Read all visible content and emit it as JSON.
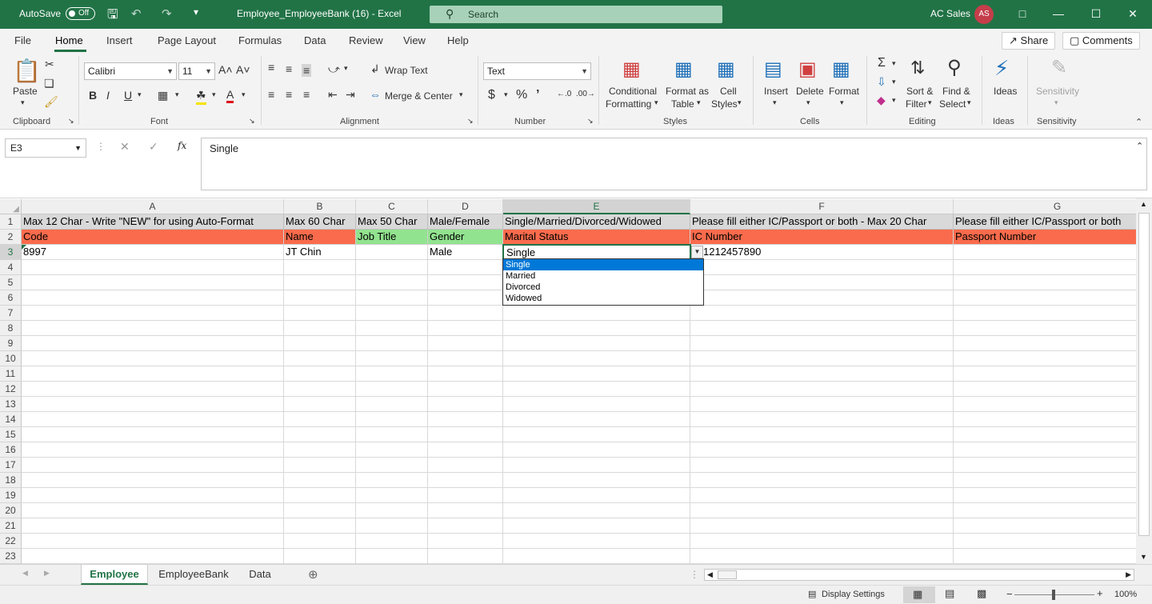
{
  "titlebar": {
    "autosave_label": "AutoSave",
    "autosave_state": "Off",
    "doc_title": "Employee_EmployeeBank (16)  -  Excel",
    "search_placeholder": "Search",
    "user_name": "AC Sales",
    "user_initials": "AS"
  },
  "ribbon_tabs": [
    "File",
    "Home",
    "Insert",
    "Page Layout",
    "Formulas",
    "Data",
    "Review",
    "View",
    "Help"
  ],
  "active_tab": "Home",
  "share_label": "Share",
  "comments_label": "Comments",
  "ribbon": {
    "clipboard": {
      "paste": "Paste",
      "label": "Clipboard"
    },
    "font": {
      "name": "Calibri",
      "size": "11",
      "label": "Font"
    },
    "alignment": {
      "wrap_text": "Wrap Text",
      "merge_center": "Merge & Center",
      "label": "Alignment"
    },
    "number": {
      "format": "Text",
      "label": "Number"
    },
    "styles": {
      "conditional_1": "Conditional",
      "conditional_2": "Formatting",
      "format_as_1": "Format as",
      "format_as_2": "Table",
      "cell_1": "Cell",
      "cell_2": "Styles",
      "label": "Styles"
    },
    "cells": {
      "insert": "Insert",
      "delete": "Delete",
      "format": "Format",
      "label": "Cells"
    },
    "editing": {
      "sort_1": "Sort &",
      "sort_2": "Filter",
      "find_1": "Find &",
      "find_2": "Select",
      "label": "Editing"
    },
    "ideas": {
      "ideas": "Ideas",
      "label": "Ideas"
    },
    "sensitivity": {
      "sensitivity": "Sensitivity",
      "label": "Sensitivity"
    }
  },
  "formula_bar": {
    "name_box": "E3",
    "fx": "fx",
    "content": "Single"
  },
  "columns": [
    "A",
    "B",
    "C",
    "D",
    "E",
    "F",
    "G"
  ],
  "rows": [
    "1",
    "2",
    "3",
    "4",
    "5",
    "6",
    "7",
    "8",
    "9",
    "10",
    "11",
    "12",
    "13",
    "14",
    "15",
    "16",
    "17",
    "18",
    "19",
    "20",
    "21",
    "22",
    "23"
  ],
  "cells": {
    "row1": [
      "Max 12 Char - Write \"NEW\" for using Auto-Format",
      "Max 60 Char",
      "Max 50 Char",
      "Male/Female",
      "Single/Married/Divorced/Widowed",
      "Please fill either IC/Passport or both - Max 20 Char",
      "Please fill either IC/Passport or both"
    ],
    "row2": [
      "Code",
      "Name",
      "Job Title",
      "Gender",
      "Marital Status",
      "IC Number",
      "Passport Number"
    ],
    "row3": [
      "8997",
      "JT Chin",
      "",
      "Male",
      "Single",
      "1212457890",
      ""
    ]
  },
  "dropdown_options": [
    "Single",
    "Married",
    "Divorced",
    "Widowed"
  ],
  "dropdown_selected": "Single",
  "sheets": [
    "Employee",
    "EmployeeBank",
    "Data"
  ],
  "active_sheet": "Employee",
  "status": {
    "display_settings": "Display Settings",
    "zoom": "100%"
  },
  "colors": {
    "accent": "#217346",
    "header_fill": "#f96b4c",
    "header_fill_green": "#92e38f"
  }
}
